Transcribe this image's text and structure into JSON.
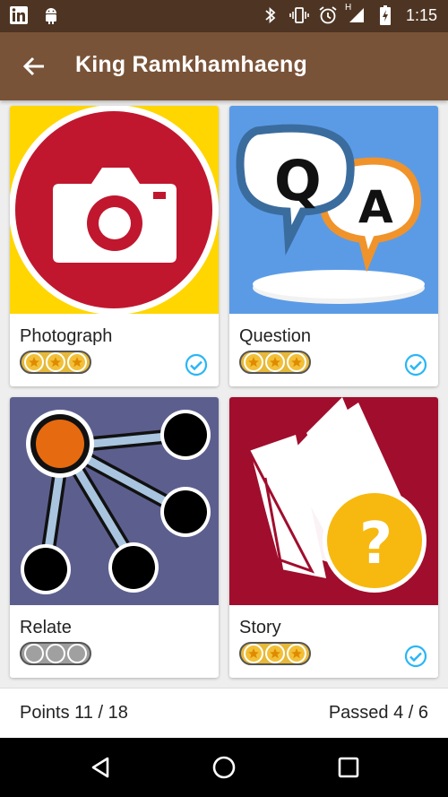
{
  "status_bar": {
    "left_icons": [
      "linkedin-icon",
      "android-icon"
    ],
    "right_icons": [
      "bluetooth-icon",
      "vibrate-icon",
      "alarm-icon",
      "signal-icon",
      "battery-charging-icon"
    ],
    "network_label": "H",
    "time": "1:15"
  },
  "app_bar": {
    "title": "King Ramkhamhaeng",
    "back_icon": "arrow-back-icon"
  },
  "activities": [
    {
      "label": "Photograph",
      "stars_earned": 3,
      "stars_total": 3,
      "passed": true,
      "icon": "camera-icon",
      "bg": "#ffd600"
    },
    {
      "label": "Question",
      "stars_earned": 3,
      "stars_total": 3,
      "passed": true,
      "icon": "qa-bubbles-icon",
      "bg": "#5b9be6"
    },
    {
      "label": "Relate",
      "stars_earned": 0,
      "stars_total": 3,
      "passed": false,
      "icon": "relate-network-icon",
      "bg": "#5c5f8e"
    },
    {
      "label": "Story",
      "stars_earned": 3,
      "stars_total": 3,
      "passed": true,
      "icon": "story-book-icon",
      "bg": "#a10d2d"
    }
  ],
  "summary": {
    "points": "Points 11 / 18",
    "passed": "Passed 4 / 6"
  },
  "colors": {
    "status_bar": "#4e3523",
    "app_bar": "#795338",
    "check_accent": "#29b6f6",
    "star_gold": "#f2c037"
  }
}
